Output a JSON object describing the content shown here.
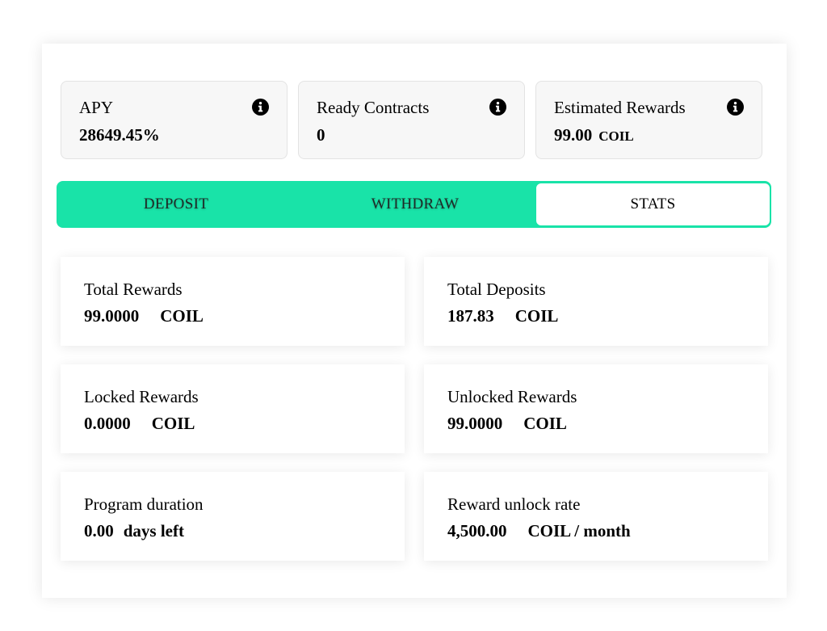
{
  "colors": {
    "accent": "#19e3a8",
    "card_bg": "#f7f7f7",
    "icon": "#000000"
  },
  "summary": [
    {
      "label": "APY",
      "value": "28649.45%",
      "unit": "",
      "icon": "info-icon"
    },
    {
      "label": "Ready Contracts",
      "value": "0",
      "unit": "",
      "icon": "info-icon"
    },
    {
      "label": "Estimated Rewards",
      "value": "99.00",
      "unit": "COIL",
      "icon": "info-icon"
    }
  ],
  "tabs": {
    "deposit": "DEPOSIT",
    "withdraw": "WITHDRAW",
    "stats": "STATS",
    "active": "STATS"
  },
  "stats": {
    "total_rewards": {
      "label": "Total Rewards",
      "value": "99.0000",
      "unit": "COIL"
    },
    "total_deposits": {
      "label": "Total Deposits",
      "value": "187.83",
      "unit": "COIL"
    },
    "locked_rewards": {
      "label": "Locked Rewards",
      "value": "0.0000",
      "unit": "COIL"
    },
    "unlocked_rewards": {
      "label": "Unlocked Rewards",
      "value": "99.0000",
      "unit": "COIL"
    },
    "program_duration": {
      "label": "Program duration",
      "value": "0.00",
      "unit": "days left"
    },
    "reward_unlock_rate": {
      "label": "Reward unlock rate",
      "value": "4,500.00",
      "unit": "COIL / month"
    }
  }
}
